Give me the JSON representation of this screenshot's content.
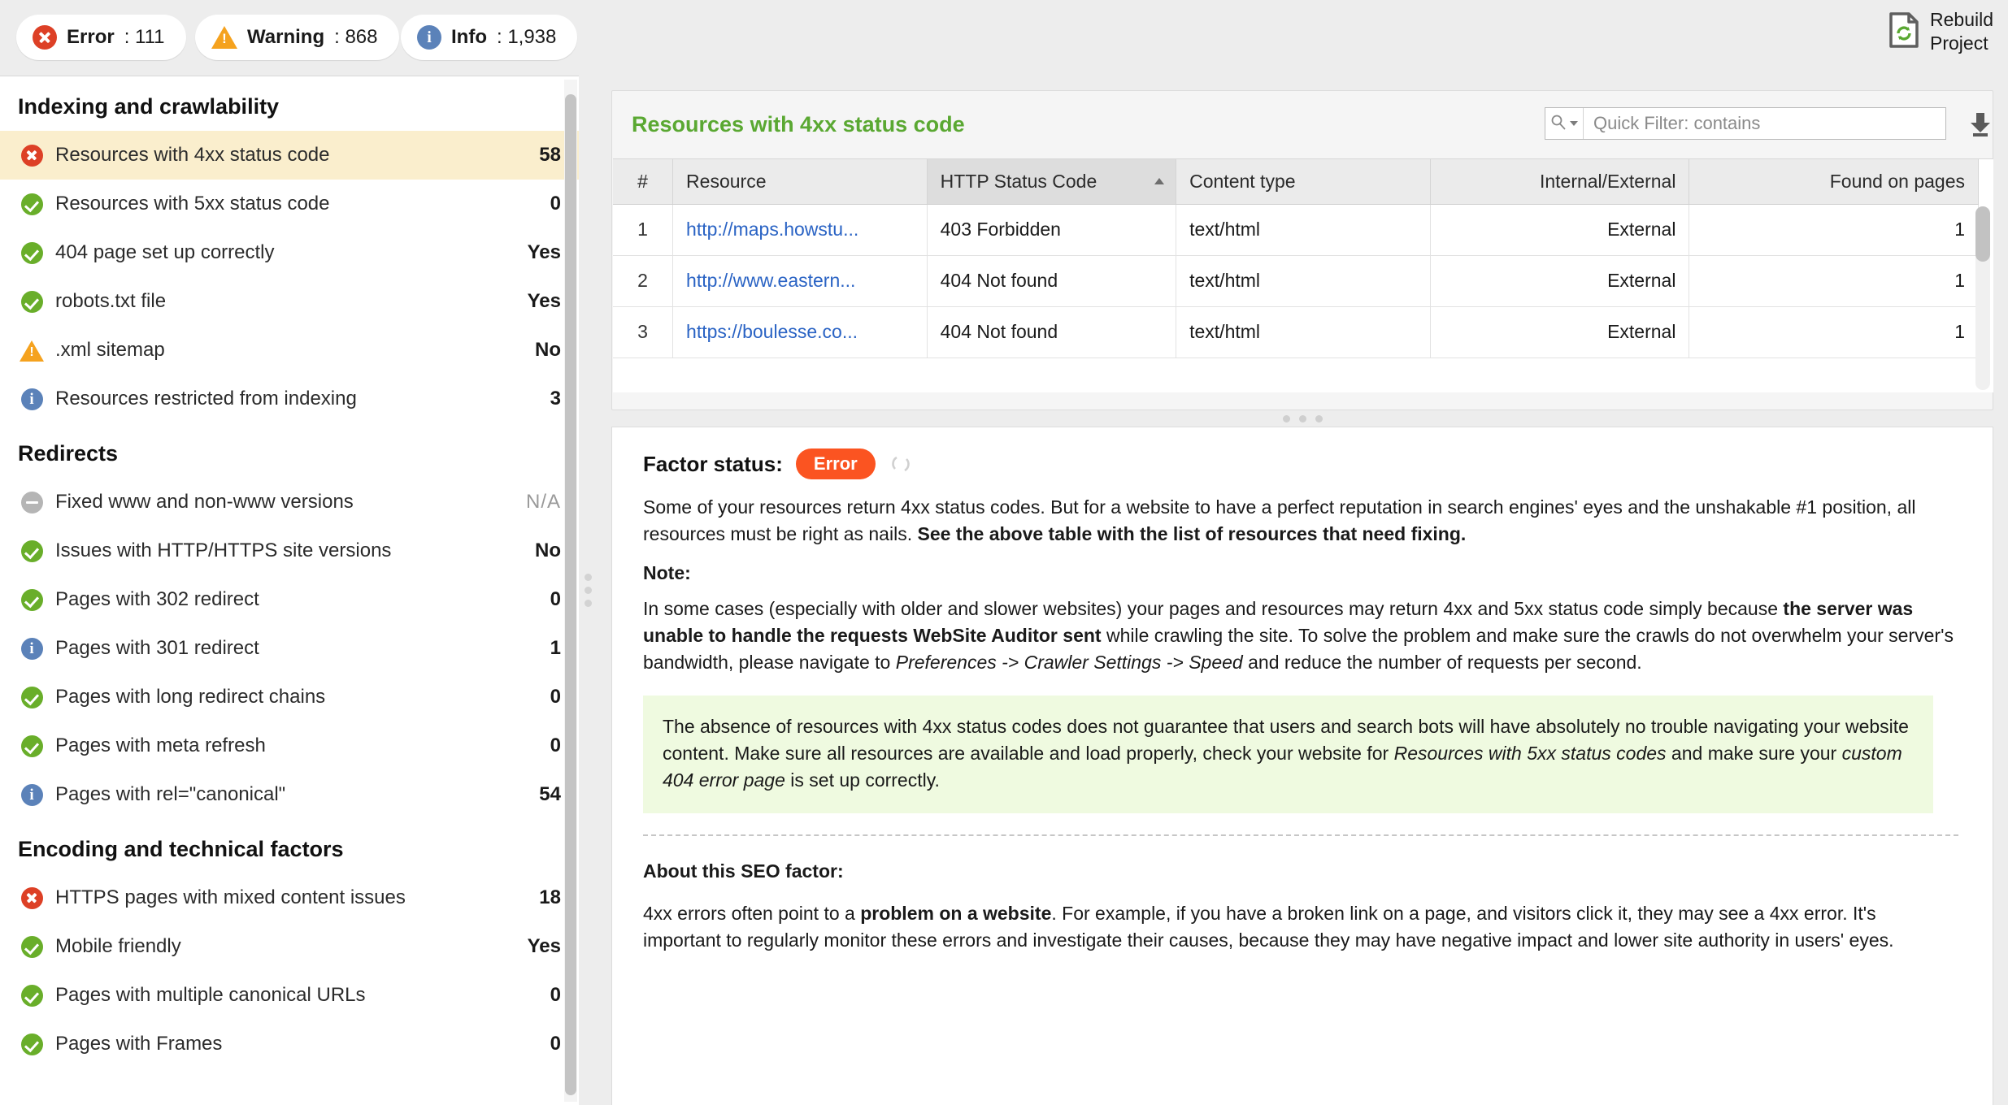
{
  "topbar": {
    "stats": [
      {
        "icon": "error-circle-icon",
        "label": "Error",
        "value": ": 111"
      },
      {
        "icon": "warning-triangle-icon",
        "label": "Warning",
        "value": ": 868"
      },
      {
        "icon": "info-circle-icon",
        "label": "Info",
        "value": ": 1,938"
      }
    ],
    "rebuild": {
      "icon": "rebuild-refresh-icon",
      "line1": "Rebuild",
      "line2": "Project"
    }
  },
  "sidebar": {
    "groups": [
      {
        "title": "Indexing and crawlability",
        "items": [
          {
            "status": "err",
            "label": "Resources with 4xx status code",
            "value": "58",
            "selected": true
          },
          {
            "status": "ok",
            "label": "Resources with 5xx status code",
            "value": "0",
            "selected": false
          },
          {
            "status": "ok",
            "label": "404 page set up correctly",
            "value": "Yes",
            "selected": false
          },
          {
            "status": "ok",
            "label": "robots.txt file",
            "value": "Yes",
            "selected": false
          },
          {
            "status": "warn",
            "label": ".xml sitemap",
            "value": "No",
            "selected": false
          },
          {
            "status": "info",
            "label": "Resources restricted from indexing",
            "value": "3",
            "selected": false
          }
        ]
      },
      {
        "title": "Redirects",
        "items": [
          {
            "status": "na",
            "label": "Fixed www and non-www versions",
            "value": "N/A",
            "selected": false
          },
          {
            "status": "ok",
            "label": "Issues with HTTP/HTTPS site versions",
            "value": "No",
            "selected": false
          },
          {
            "status": "ok",
            "label": "Pages with 302 redirect",
            "value": "0",
            "selected": false
          },
          {
            "status": "info",
            "label": "Pages with 301 redirect",
            "value": "1",
            "selected": false
          },
          {
            "status": "ok",
            "label": "Pages with long redirect chains",
            "value": "0",
            "selected": false
          },
          {
            "status": "ok",
            "label": "Pages with meta refresh",
            "value": "0",
            "selected": false
          },
          {
            "status": "info",
            "label": "Pages with rel=\"canonical\"",
            "value": "54",
            "selected": false
          }
        ]
      },
      {
        "title": "Encoding and technical factors",
        "items": [
          {
            "status": "err",
            "label": "HTTPS pages with mixed content issues",
            "value": "18",
            "selected": false
          },
          {
            "status": "ok",
            "label": "Mobile friendly",
            "value": "Yes",
            "selected": false
          },
          {
            "status": "ok",
            "label": "Pages with multiple canonical URLs",
            "value": "0",
            "selected": false
          },
          {
            "status": "ok",
            "label": "Pages with Frames",
            "value": "0",
            "selected": false
          }
        ]
      }
    ]
  },
  "panel": {
    "title": "Resources with 4xx status code",
    "quick_filter": {
      "placeholder": "Quick Filter: contains",
      "value": "",
      "icon": "search-icon"
    },
    "download_icon": "download-icon",
    "table": {
      "columns": [
        {
          "label": "#",
          "align": "center",
          "sorted": false
        },
        {
          "label": "Resource",
          "align": "left",
          "sorted": false
        },
        {
          "label": "HTTP Status Code",
          "align": "left",
          "sorted": true,
          "sort_dir": "asc"
        },
        {
          "label": "Content type",
          "align": "left",
          "sorted": false
        },
        {
          "label": "Internal/External",
          "align": "right",
          "sorted": false
        },
        {
          "label": "Found on pages",
          "align": "right",
          "sorted": false
        }
      ],
      "rows": [
        {
          "num": "1",
          "resource": "http://maps.howstu...",
          "status": "403 Forbidden",
          "content_type": "text/html",
          "scope": "External",
          "found_on_pages": "1"
        },
        {
          "num": "2",
          "resource": "http://www.eastern...",
          "status": "404 Not found",
          "content_type": "text/html",
          "scope": "External",
          "found_on_pages": "1"
        },
        {
          "num": "3",
          "resource": "https://boulesse.co...",
          "status": "404 Not found",
          "content_type": "text/html",
          "scope": "External",
          "found_on_pages": "1"
        }
      ]
    }
  },
  "detail": {
    "factor_status_label": "Factor status:",
    "factor_status_badge": "Error",
    "refresh_icon": "refresh-icon",
    "intro_a": "Some of your resources return 4xx status codes. But for a website to have a perfect reputation in search engines' eyes and the unshakable #1 position, all resources must be right as nails. ",
    "intro_b": "See the above table with the list of resources that need fixing.",
    "note_heading": "Note:",
    "note_a": "In some cases (especially with older and slower websites) your pages and resources may return 4xx and 5xx status code simply because ",
    "note_b": "the server was unable to handle the requests WebSite Auditor sent",
    "note_c": " while crawling the site. To solve the problem and make sure the crawls do not overwhelm your server's bandwidth, please navigate to ",
    "note_d": "Preferences -> Crawler Settings -> Speed",
    "note_e": " and reduce the number of requests per second.",
    "tip_a": "The absence of resources with 4xx status codes does not guarantee that users and search bots will have absolutely no trouble navigating your website content. Make sure all resources are available and load properly, check your website for ",
    "tip_b": "Resources with 5xx status codes",
    "tip_c": " and make sure your ",
    "tip_d": "custom 404 error page",
    "tip_e": " is set up correctly.",
    "about_heading": "About this SEO factor:",
    "about_a": "4xx errors often point to a ",
    "about_b": "problem on a website",
    "about_c": ". For example, if you have a broken link on a page, and visitors click it, they may see a 4xx error. It's important to regularly monitor these errors and investigate their causes, because they may have negative impact and lower site authority in users' eyes."
  },
  "colors": {
    "error": "#dd4026",
    "warning": "#f5a21e",
    "info": "#5b82b9",
    "ok": "#69ae2a",
    "accent_green": "#5aa832",
    "badge_orange": "#fb5421",
    "selected_row": "#faeecd",
    "tip_bg": "#effae0"
  }
}
